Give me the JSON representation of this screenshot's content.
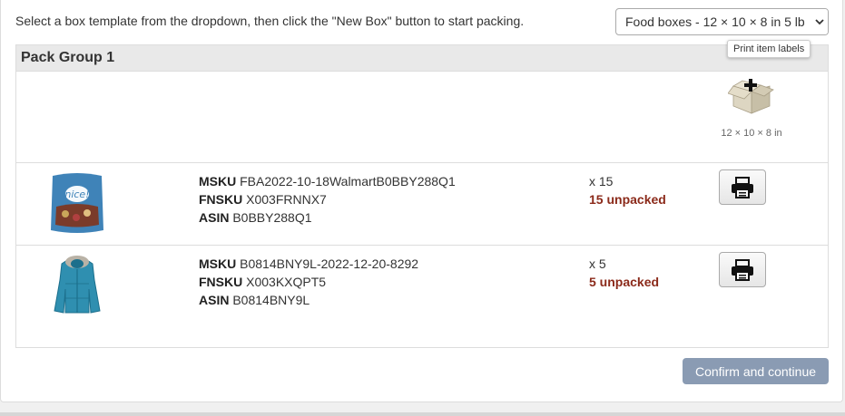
{
  "instructions": "Select a box template from the dropdown, then click the \"New Box\" button to start packing.",
  "box_template_select": {
    "selected": "Food boxes - 12 × 10 × 8 in 5 lb"
  },
  "pack_group": {
    "title": "Pack Group 1",
    "new_box": {
      "icon": "new-box-icon",
      "dimensions": "12 × 10 × 8 in"
    },
    "items": [
      {
        "image": "snack-bag-product-image",
        "msku_label": "MSKU",
        "msku": "FBA2022-10-18WalmartB0BBY288Q1",
        "fnsku_label": "FNSKU",
        "fnsku": "X003FRNNX7",
        "asin_label": "ASIN",
        "asin": "B0BBY288Q1",
        "quantity": "x 15",
        "unpacked": "15 unpacked"
      },
      {
        "image": "blue-jacket-product-image",
        "msku_label": "MSKU",
        "msku": "B0814BNY9L-2022-12-20-8292",
        "fnsku_label": "FNSKU",
        "fnsku": "X003KXQPT5",
        "asin_label": "ASIN",
        "asin": "B0814BNY9L",
        "quantity": "x 5",
        "unpacked": "5 unpacked"
      }
    ]
  },
  "tooltip": "Print item labels",
  "confirm_button": "Confirm and continue",
  "colors": {
    "unpacked": "#8b2a1a",
    "confirm_bg": "#8a9bb3",
    "header_bg": "#e9e9e9"
  }
}
